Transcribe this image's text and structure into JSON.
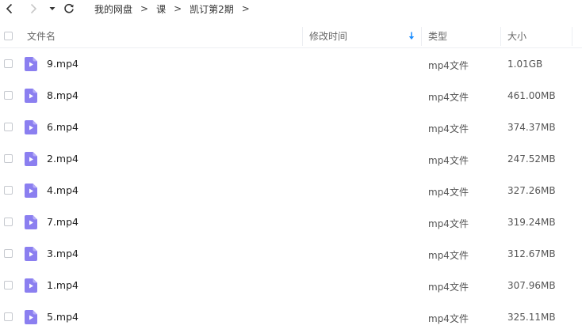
{
  "toolbar": {
    "back_icon": "chevron-left-icon",
    "forward_icon": "chevron-right-icon",
    "history_icon": "caret-down-icon",
    "refresh_icon": "refresh-icon"
  },
  "breadcrumb": [
    "我的网盘",
    "课",
    "凯订第2期"
  ],
  "breadcrumb_separator": ">",
  "columns": {
    "name": "文件名",
    "modified": "修改时间",
    "type": "类型",
    "size": "大小"
  },
  "sort": {
    "column": "modified",
    "direction": "down",
    "color": "#1a8cff"
  },
  "file_icon": {
    "name": "video-file-icon",
    "color": "#8b7ff0"
  },
  "files": [
    {
      "name": "9.mp4",
      "type": "mp4文件",
      "size": "1.01GB"
    },
    {
      "name": "8.mp4",
      "type": "mp4文件",
      "size": "461.00MB"
    },
    {
      "name": "6.mp4",
      "type": "mp4文件",
      "size": "374.37MB"
    },
    {
      "name": "2.mp4",
      "type": "mp4文件",
      "size": "247.52MB"
    },
    {
      "name": "4.mp4",
      "type": "mp4文件",
      "size": "327.26MB"
    },
    {
      "name": "7.mp4",
      "type": "mp4文件",
      "size": "319.24MB"
    },
    {
      "name": "3.mp4",
      "type": "mp4文件",
      "size": "312.67MB"
    },
    {
      "name": "1.mp4",
      "type": "mp4文件",
      "size": "307.96MB"
    },
    {
      "name": "5.mp4",
      "type": "mp4文件",
      "size": "325.11MB"
    }
  ]
}
